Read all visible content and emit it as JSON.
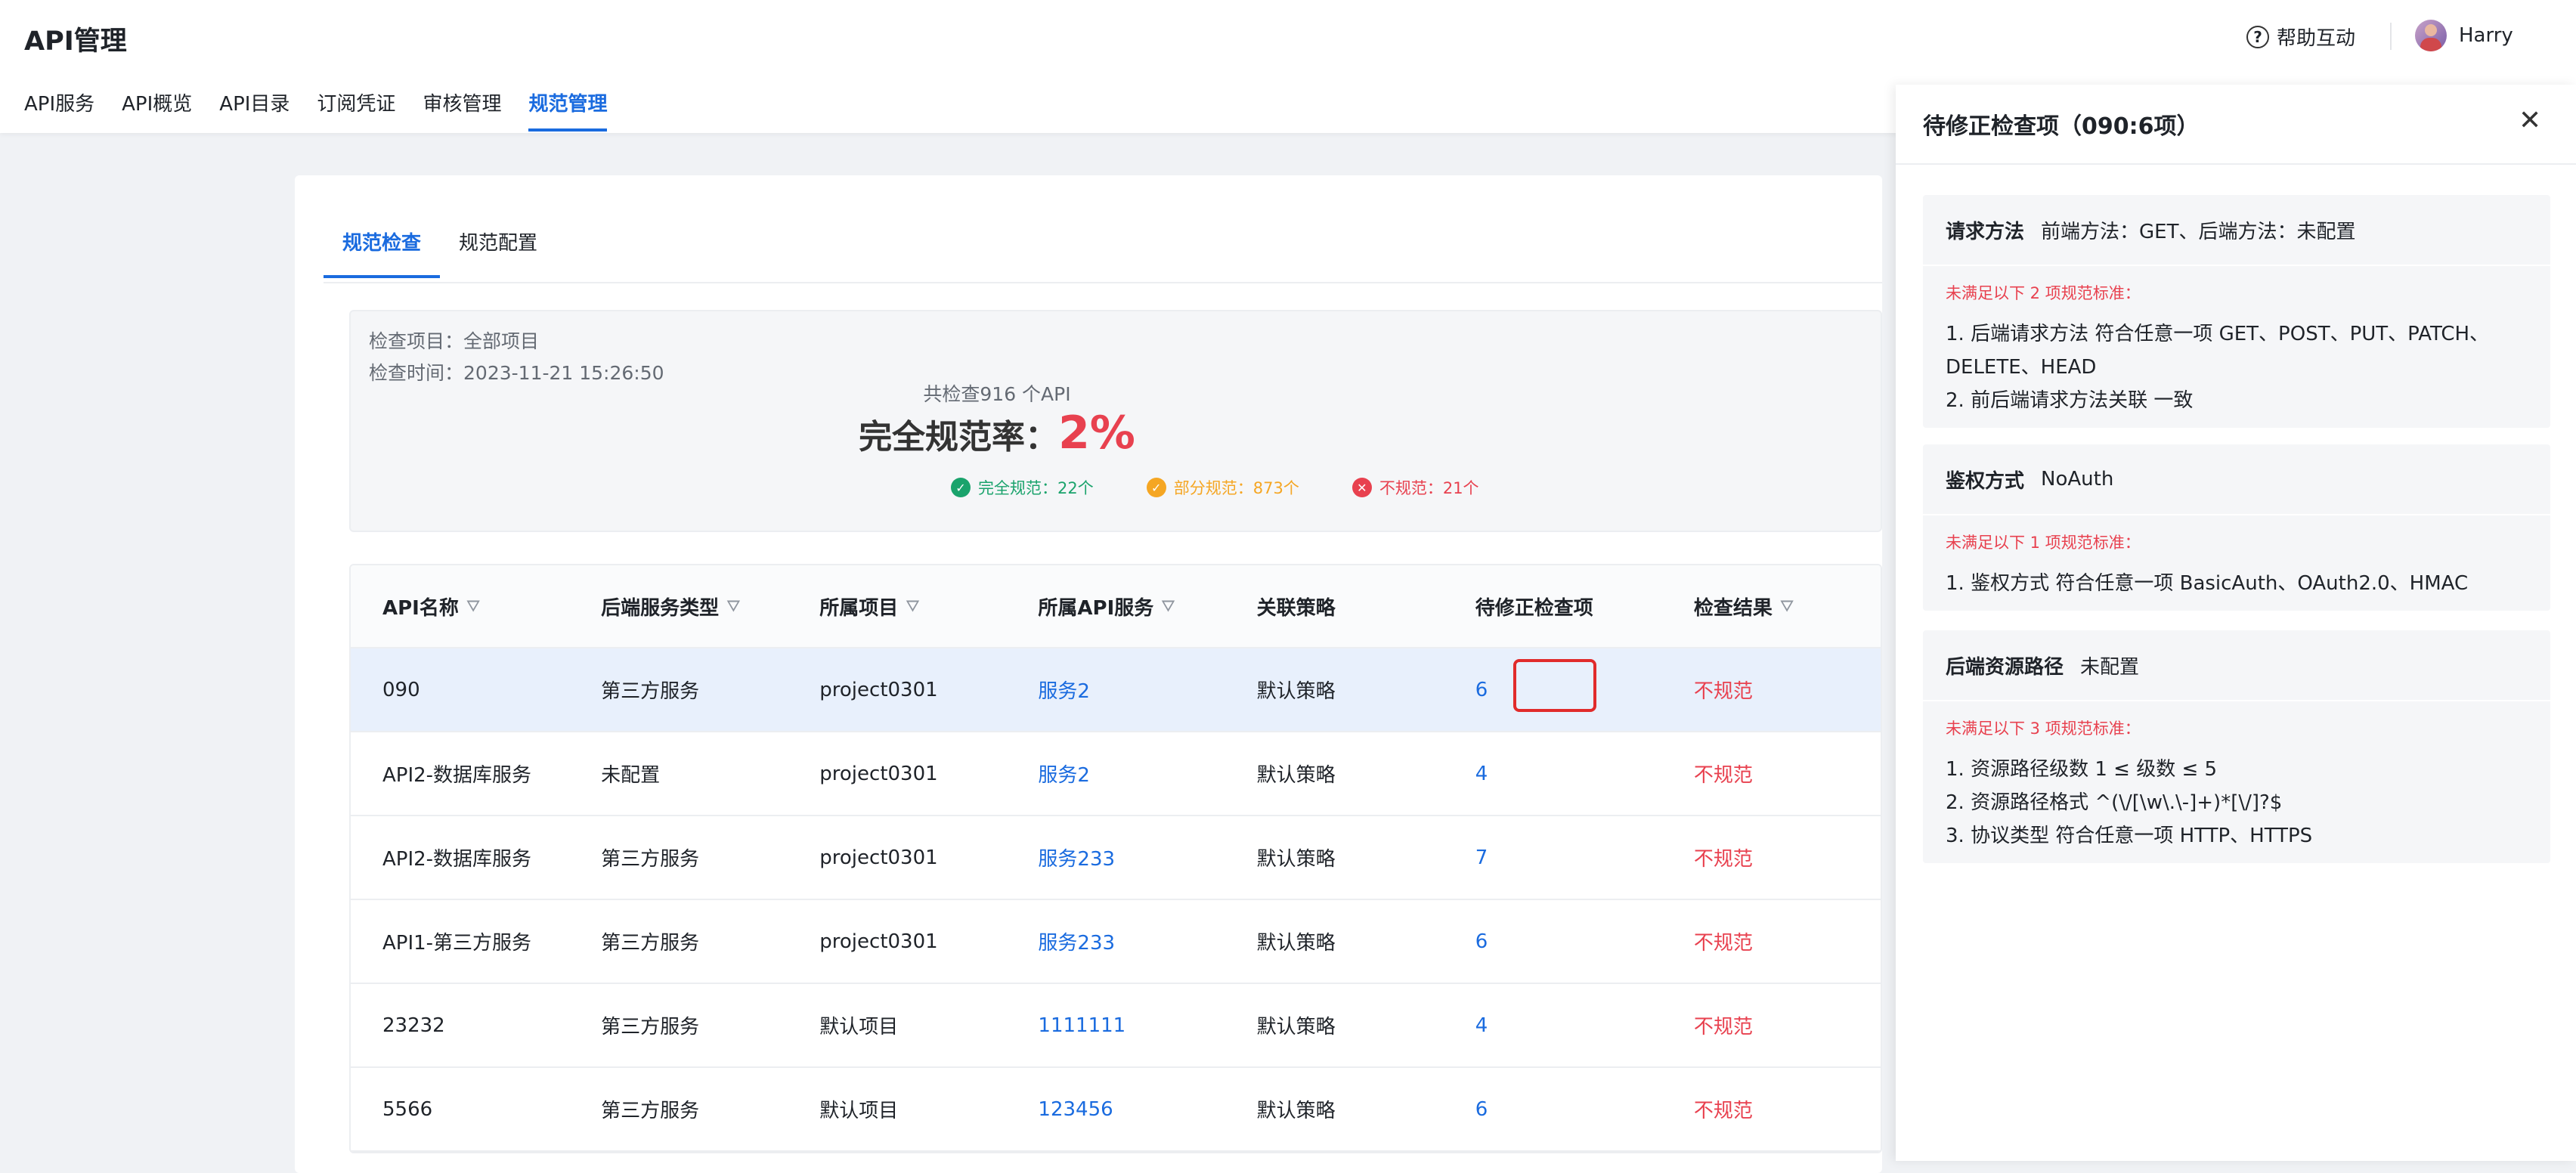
{
  "header": {
    "app_title": "API管理",
    "help_label": "帮助互动",
    "user_name": "Harry"
  },
  "nav": {
    "items": [
      {
        "label": "API服务"
      },
      {
        "label": "API概览"
      },
      {
        "label": "API目录"
      },
      {
        "label": "订阅凭证"
      },
      {
        "label": "审核管理"
      },
      {
        "label": "规范管理",
        "active": true
      }
    ]
  },
  "tabs": [
    {
      "label": "规范检查",
      "active": true
    },
    {
      "label": "规范配置"
    }
  ],
  "summary": {
    "project_label": "检查项目：",
    "project_value": "全部项目",
    "time_label": "检查时间：",
    "time_value": "2023-11-21 15:26:50",
    "total_text": "共检查916 个API",
    "rate_label": "完全规范率：",
    "rate_value": "2%",
    "legend": {
      "full": "完全规范：22个",
      "partial": "部分规范：873个",
      "none": "不规范：21个"
    },
    "colors": {
      "full": "#1aa36c",
      "partial": "#f5a623",
      "none": "#e8414f"
    }
  },
  "table": {
    "headers": {
      "name": "API名称",
      "backend_type": "后端服务类型",
      "project": "所属项目",
      "service": "所属API服务",
      "policy": "关联策略",
      "pending": "待修正检查项",
      "result": "检查结果"
    },
    "rows": [
      {
        "name": "090",
        "backend_type": "第三方服务",
        "project": "project0301",
        "service": "服务2",
        "policy": "默认策略",
        "pending": "6",
        "result": "不规范"
      },
      {
        "name": "API2-数据库服务",
        "backend_type": "未配置",
        "project": "project0301",
        "service": "服务2",
        "policy": "默认策略",
        "pending": "4",
        "result": "不规范"
      },
      {
        "name": "API2-数据库服务",
        "backend_type": "第三方服务",
        "project": "project0301",
        "service": "服务233",
        "policy": "默认策略",
        "pending": "7",
        "result": "不规范"
      },
      {
        "name": "API1-第三方服务",
        "backend_type": "第三方服务",
        "project": "project0301",
        "service": "服务233",
        "policy": "默认策略",
        "pending": "6",
        "result": "不规范"
      },
      {
        "name": "23232",
        "backend_type": "第三方服务",
        "project": "默认项目",
        "service": "1111111",
        "policy": "默认策略",
        "pending": "4",
        "result": "不规范"
      },
      {
        "name": "5566",
        "backend_type": "第三方服务",
        "project": "默认项目",
        "service": "123456",
        "policy": "默认策略",
        "pending": "6",
        "result": "不规范"
      }
    ]
  },
  "panel": {
    "title": "待修正检查项（090:6项）",
    "rules": [
      {
        "name": "请求方法",
        "value": "前端方法：GET、后端方法：未配置",
        "warning": "未满足以下 2 项规范标准：",
        "items": [
          "1. 后端请求方法  符合任意一项    GET、POST、PUT、PATCH、DELETE、HEAD",
          "2. 前后端请求方法关联  一致"
        ]
      },
      {
        "name": "鉴权方式",
        "value": "NoAuth",
        "warning": "未满足以下 1 项规范标准：",
        "items": [
          "1. 鉴权方式  符合任意一项    BasicAuth、OAuth2.0、HMAC"
        ]
      },
      {
        "name": "后端资源路径",
        "value": "未配置",
        "warning": "未满足以下 3 项规范标准：",
        "items": [
          "1. 资源路径级数  1 ≤ 级数 ≤ 5",
          "2. 资源路径格式  ^(\\/[\\w\\.\\-]+)*[\\/]?$",
          "3. 协议类型  符合任意一项    HTTP、HTTPS"
        ]
      }
    ]
  }
}
